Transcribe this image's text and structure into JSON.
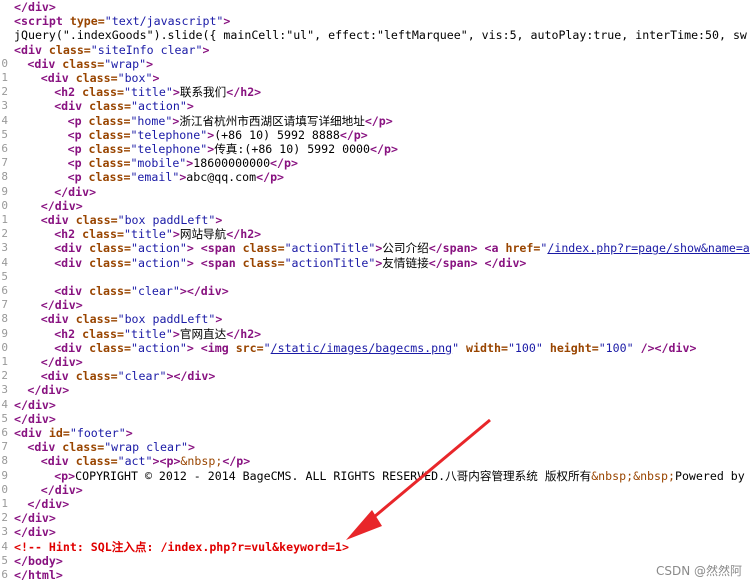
{
  "watermark": "CSDN @然然阿",
  "lines": [
    {
      "n": "",
      "indent": 0,
      "parts": [
        [
          "tag",
          "</div>"
        ]
      ]
    },
    {
      "n": "",
      "indent": 0,
      "parts": [
        [
          "tag",
          "<script "
        ],
        [
          "attr",
          "type="
        ],
        [
          "val",
          "\"text/javascript\""
        ],
        [
          "tag",
          ">"
        ]
      ]
    },
    {
      "n": "",
      "indent": 0,
      "parts": [
        [
          "txt",
          "jQuery(\".indexGoods\").slide({ mainCell:\"ul\", effect:\"leftMarquee\", vis:5, autoPlay:true, interTime:50, sw"
        ]
      ]
    },
    {
      "n": "",
      "indent": 0,
      "parts": [
        [
          "tag",
          "<div "
        ],
        [
          "attr",
          "class="
        ],
        [
          "val",
          "\"siteInfo clear\""
        ],
        [
          "tag",
          ">"
        ]
      ]
    },
    {
      "n": "0",
      "indent": 1,
      "parts": [
        [
          "tag",
          "<div "
        ],
        [
          "attr",
          "class="
        ],
        [
          "val",
          "\"wrap\""
        ],
        [
          "tag",
          ">"
        ]
      ]
    },
    {
      "n": "1",
      "indent": 2,
      "parts": [
        [
          "tag",
          "<div "
        ],
        [
          "attr",
          "class="
        ],
        [
          "val",
          "\"box\""
        ],
        [
          "tag",
          ">"
        ]
      ]
    },
    {
      "n": "2",
      "indent": 3,
      "parts": [
        [
          "tag",
          "<h2 "
        ],
        [
          "attr",
          "class="
        ],
        [
          "val",
          "\"title\""
        ],
        [
          "tag",
          ">"
        ],
        [
          "txt",
          "联系我们"
        ],
        [
          "tag",
          "</h2>"
        ]
      ]
    },
    {
      "n": "3",
      "indent": 3,
      "parts": [
        [
          "tag",
          "<div "
        ],
        [
          "attr",
          "class="
        ],
        [
          "val",
          "\"action\""
        ],
        [
          "tag",
          ">"
        ]
      ]
    },
    {
      "n": "4",
      "indent": 4,
      "parts": [
        [
          "tag",
          "<p "
        ],
        [
          "attr",
          "class="
        ],
        [
          "val",
          "\"home\""
        ],
        [
          "tag",
          ">"
        ],
        [
          "txt",
          "浙江省杭州市西湖区请填写详细地址"
        ],
        [
          "tag",
          "</p>"
        ]
      ]
    },
    {
      "n": "5",
      "indent": 4,
      "parts": [
        [
          "tag",
          "<p "
        ],
        [
          "attr",
          "class="
        ],
        [
          "val",
          "\"telephone\""
        ],
        [
          "tag",
          ">"
        ],
        [
          "txt",
          "(+86 10) 5992 8888"
        ],
        [
          "tag",
          "</p>"
        ]
      ]
    },
    {
      "n": "6",
      "indent": 4,
      "parts": [
        [
          "tag",
          "<p "
        ],
        [
          "attr",
          "class="
        ],
        [
          "val",
          "\"telephone\""
        ],
        [
          "tag",
          ">"
        ],
        [
          "txt",
          "传真:(+86 10) 5992 0000"
        ],
        [
          "tag",
          "</p>"
        ]
      ]
    },
    {
      "n": "7",
      "indent": 4,
      "parts": [
        [
          "tag",
          "<p "
        ],
        [
          "attr",
          "class="
        ],
        [
          "val",
          "\"mobile\""
        ],
        [
          "tag",
          ">"
        ],
        [
          "txt",
          "18600000000"
        ],
        [
          "tag",
          "</p>"
        ]
      ]
    },
    {
      "n": "8",
      "indent": 4,
      "parts": [
        [
          "tag",
          "<p "
        ],
        [
          "attr",
          "class="
        ],
        [
          "val",
          "\"email\""
        ],
        [
          "tag",
          ">"
        ],
        [
          "txt",
          "abc@qq.com"
        ],
        [
          "tag",
          "</p>"
        ]
      ]
    },
    {
      "n": "9",
      "indent": 3,
      "parts": [
        [
          "tag",
          "</div>"
        ]
      ]
    },
    {
      "n": "0",
      "indent": 2,
      "parts": [
        [
          "tag",
          "</div>"
        ]
      ]
    },
    {
      "n": "1",
      "indent": 2,
      "parts": [
        [
          "tag",
          "<div "
        ],
        [
          "attr",
          "class="
        ],
        [
          "val",
          "\"box paddLeft\""
        ],
        [
          "tag",
          ">"
        ]
      ]
    },
    {
      "n": "2",
      "indent": 3,
      "parts": [
        [
          "tag",
          "<h2 "
        ],
        [
          "attr",
          "class="
        ],
        [
          "val",
          "\"title\""
        ],
        [
          "tag",
          ">"
        ],
        [
          "txt",
          "网站导航"
        ],
        [
          "tag",
          "</h2>"
        ]
      ]
    },
    {
      "n": "3",
      "indent": 3,
      "parts": [
        [
          "tag",
          "<div "
        ],
        [
          "attr",
          "class="
        ],
        [
          "val",
          "\"action\""
        ],
        [
          "tag",
          "> <span "
        ],
        [
          "attr",
          "class="
        ],
        [
          "val",
          "\"actionTitle\""
        ],
        [
          "tag",
          ">"
        ],
        [
          "txt",
          "公司介绍"
        ],
        [
          "tag",
          "</span> <a "
        ],
        [
          "attr",
          "href="
        ],
        [
          "val",
          "\""
        ],
        [
          "link",
          "/index.php?r=page/show&name=a"
        ]
      ]
    },
    {
      "n": "4",
      "indent": 3,
      "parts": [
        [
          "tag",
          "<div "
        ],
        [
          "attr",
          "class="
        ],
        [
          "val",
          "\"action\""
        ],
        [
          "tag",
          "> <span "
        ],
        [
          "attr",
          "class="
        ],
        [
          "val",
          "\"actionTitle\""
        ],
        [
          "tag",
          ">"
        ],
        [
          "txt",
          "友情链接"
        ],
        [
          "tag",
          "</span> </div>"
        ]
      ]
    },
    {
      "n": "5",
      "indent": 0,
      "parts": []
    },
    {
      "n": "6",
      "indent": 3,
      "parts": [
        [
          "tag",
          "<div "
        ],
        [
          "attr",
          "class="
        ],
        [
          "val",
          "\"clear\""
        ],
        [
          "tag",
          "></div>"
        ]
      ]
    },
    {
      "n": "7",
      "indent": 2,
      "parts": [
        [
          "tag",
          "</div>"
        ]
      ]
    },
    {
      "n": "8",
      "indent": 2,
      "parts": [
        [
          "tag",
          "<div "
        ],
        [
          "attr",
          "class="
        ],
        [
          "val",
          "\"box paddLeft\""
        ],
        [
          "tag",
          ">"
        ]
      ]
    },
    {
      "n": "9",
      "indent": 3,
      "parts": [
        [
          "tag",
          "<h2 "
        ],
        [
          "attr",
          "class="
        ],
        [
          "val",
          "\"title\""
        ],
        [
          "tag",
          ">"
        ],
        [
          "txt",
          "官网直达"
        ],
        [
          "tag",
          "</h2>"
        ]
      ]
    },
    {
      "n": "0",
      "indent": 3,
      "parts": [
        [
          "tag",
          "<div "
        ],
        [
          "attr",
          "class="
        ],
        [
          "val",
          "\"action\""
        ],
        [
          "tag",
          "> <img "
        ],
        [
          "attr",
          "src="
        ],
        [
          "val",
          "\""
        ],
        [
          "link",
          "/static/images/bagecms.png"
        ],
        [
          "val",
          "\""
        ],
        [
          "attr",
          " width="
        ],
        [
          "val",
          "\"100\""
        ],
        [
          "attr",
          " height="
        ],
        [
          "val",
          "\"100\""
        ],
        [
          "tag",
          " /></div>"
        ]
      ]
    },
    {
      "n": "1",
      "indent": 2,
      "parts": [
        [
          "tag",
          "</div>"
        ]
      ]
    },
    {
      "n": "2",
      "indent": 2,
      "parts": [
        [
          "tag",
          "<div "
        ],
        [
          "attr",
          "class="
        ],
        [
          "val",
          "\"clear\""
        ],
        [
          "tag",
          "></div>"
        ]
      ]
    },
    {
      "n": "3",
      "indent": 1,
      "parts": [
        [
          "tag",
          "</div>"
        ]
      ]
    },
    {
      "n": "4",
      "indent": 0,
      "parts": [
        [
          "tag",
          "</div>"
        ]
      ]
    },
    {
      "n": "5",
      "indent": 0,
      "parts": [
        [
          "tag",
          "</div>"
        ]
      ]
    },
    {
      "n": "6",
      "indent": 0,
      "parts": [
        [
          "tag",
          "<div "
        ],
        [
          "attr",
          "id="
        ],
        [
          "val",
          "\"footer\""
        ],
        [
          "tag",
          ">"
        ]
      ]
    },
    {
      "n": "7",
      "indent": 1,
      "parts": [
        [
          "tag",
          "<div "
        ],
        [
          "attr",
          "class="
        ],
        [
          "val",
          "\"wrap clear\""
        ],
        [
          "tag",
          ">"
        ]
      ]
    },
    {
      "n": "8",
      "indent": 2,
      "parts": [
        [
          "tag",
          "<div "
        ],
        [
          "attr",
          "class="
        ],
        [
          "val",
          "\"act\""
        ],
        [
          "tag",
          "><p>"
        ],
        [
          "ent",
          "&nbsp;"
        ],
        [
          "tag",
          "</p>"
        ]
      ]
    },
    {
      "n": "9",
      "indent": 3,
      "parts": [
        [
          "tag",
          "<p>"
        ],
        [
          "txt",
          "COPYRIGHT © 2012 - 2014 BageCMS. ALL RIGHTS RESERVED.八哥内容管理系统 版权所有"
        ],
        [
          "ent",
          "&nbsp;&nbsp;"
        ],
        [
          "txt",
          "Powered by"
        ]
      ]
    },
    {
      "n": "0",
      "indent": 2,
      "parts": [
        [
          "tag",
          "</div>"
        ]
      ]
    },
    {
      "n": "1",
      "indent": 1,
      "parts": [
        [
          "tag",
          "</div>"
        ]
      ]
    },
    {
      "n": "2",
      "indent": 0,
      "parts": [
        [
          "tag",
          "</div>"
        ]
      ]
    },
    {
      "n": "3",
      "indent": 0,
      "parts": [
        [
          "tag",
          "</div>"
        ]
      ]
    },
    {
      "n": "4",
      "indent": 0,
      "parts": [
        [
          "cmt",
          "<!-- Hint: SQL注入点: /index.php?r=vul&keyword=1>"
        ]
      ]
    },
    {
      "n": "5",
      "indent": 0,
      "parts": [
        [
          "tag",
          "</body>"
        ]
      ]
    },
    {
      "n": "6",
      "indent": 0,
      "parts": [
        [
          "tag",
          "</html>"
        ]
      ]
    }
  ]
}
